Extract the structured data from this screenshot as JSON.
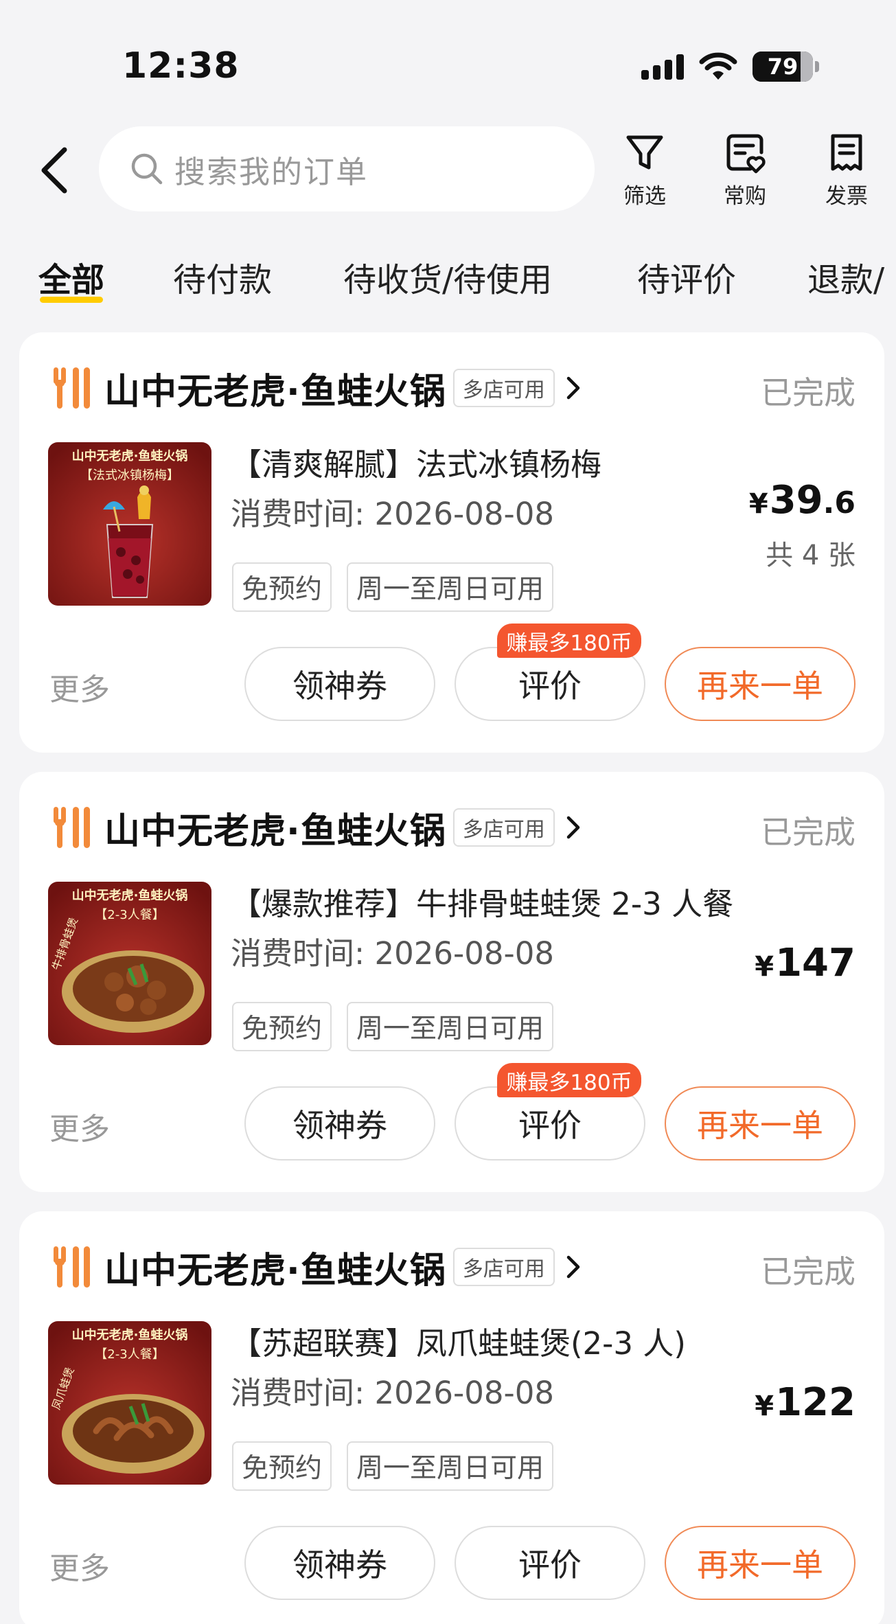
{
  "status_bar": {
    "time": "12:38",
    "battery": "79"
  },
  "search": {
    "placeholder": "搜索我的订单"
  },
  "header_actions": [
    {
      "label": "筛选",
      "icon": "filter-icon"
    },
    {
      "label": "常购",
      "icon": "frequent-buy-icon"
    },
    {
      "label": "发票",
      "icon": "invoice-icon"
    }
  ],
  "tabs": [
    "全部",
    "待付款",
    "待收货/待使用",
    "待评价",
    "退款/"
  ],
  "active_tab": "全部",
  "colors": {
    "accent": "#ffcc00",
    "orange": "#f26a2a",
    "badge": "#f4562f",
    "shop_icon": "#f28a3a"
  },
  "orders": [
    {
      "shop_name": "山中无老虎·鱼蛙火锅",
      "multi_store": "多店可用",
      "status": "已完成",
      "product_title": "【清爽解腻】法式冰镇杨梅",
      "consume_time": "消费时间: 2026-08-08",
      "tags": [
        "免预约",
        "周一至周日可用"
      ],
      "price_symbol": "¥",
      "price_int": "39",
      "price_dec": ".6",
      "quantity": "共 4 张",
      "more": "更多",
      "buttons": {
        "coupon": "领神券",
        "review": "评价",
        "reorder": "再来一单"
      },
      "reward_badge": "赚最多180币",
      "thumb_banner": "山中无老虎·鱼蛙火锅",
      "thumb_subtitle": "【法式冰镇杨梅】"
    },
    {
      "shop_name": "山中无老虎·鱼蛙火锅",
      "multi_store": "多店可用",
      "status": "已完成",
      "product_title": "【爆款推荐】牛排骨蛙蛙煲 2-3 人餐",
      "consume_time": "消费时间: 2026-08-08",
      "tags": [
        "免预约",
        "周一至周日可用"
      ],
      "price_symbol": "¥",
      "price_int": "147",
      "price_dec": "",
      "quantity": "",
      "more": "更多",
      "buttons": {
        "coupon": "领神券",
        "review": "评价",
        "reorder": "再来一单"
      },
      "reward_badge": "赚最多180币",
      "thumb_banner": "山中无老虎·鱼蛙火锅",
      "thumb_subtitle": "【2-3人餐】",
      "thumb_side": "牛排骨蛙煲"
    },
    {
      "shop_name": "山中无老虎·鱼蛙火锅",
      "multi_store": "多店可用",
      "status": "已完成",
      "product_title": "【苏超联赛】凤爪蛙蛙煲(2-3 人)",
      "consume_time": "消费时间: 2026-08-08",
      "tags": [
        "免预约",
        "周一至周日可用"
      ],
      "price_symbol": "¥",
      "price_int": "122",
      "price_dec": "",
      "quantity": "",
      "more": "更多",
      "buttons": {
        "coupon": "领神券",
        "review": "评价",
        "reorder": "再来一单"
      },
      "reward_badge": "",
      "thumb_banner": "山中无老虎·鱼蛙火锅",
      "thumb_subtitle": "【2-3人餐】",
      "thumb_side": "凤爪蛙煲"
    }
  ]
}
